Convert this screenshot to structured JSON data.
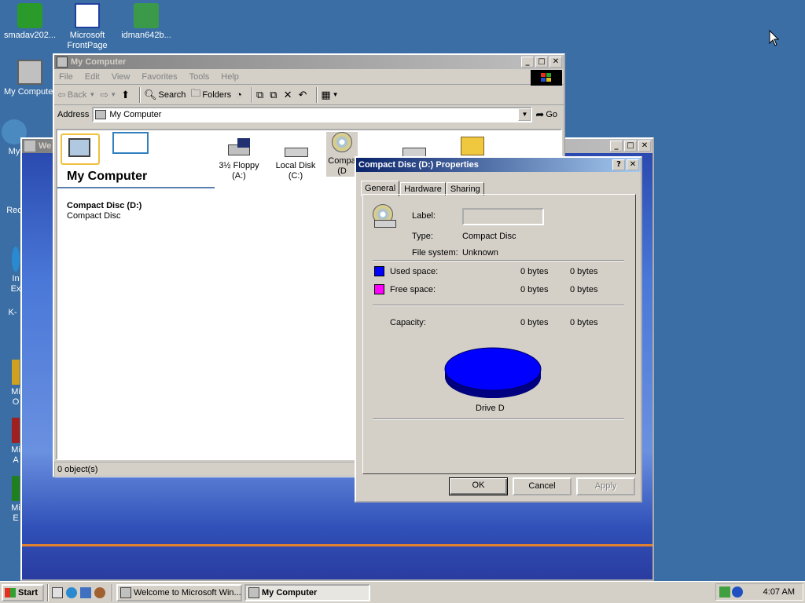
{
  "desktop": {
    "icons": [
      {
        "label": "smadav202..."
      },
      {
        "label": "Microsoft FrontPage"
      },
      {
        "label": "idman642b..."
      },
      {
        "label": "My Computer"
      },
      {
        "label": "My"
      },
      {
        "label": "Rec"
      },
      {
        "label": "In Ex"
      },
      {
        "label": "K-"
      },
      {
        "label": "Mi O"
      },
      {
        "label": "Mi A"
      },
      {
        "label": "Mi E"
      }
    ]
  },
  "background_window": {
    "title": "We"
  },
  "explorer": {
    "title": "My Computer",
    "menu": [
      "File",
      "Edit",
      "View",
      "Favorites",
      "Tools",
      "Help"
    ],
    "toolbar": {
      "back": "Back",
      "search": "Search",
      "folders": "Folders"
    },
    "address": {
      "label": "Address",
      "value": "My Computer",
      "go": "Go"
    },
    "left_pane": {
      "heading": "My Computer",
      "selected_name": "Compact Disc (D:)",
      "selected_type": "Compact Disc"
    },
    "drives": [
      {
        "label": "3½ Floppy (A:)"
      },
      {
        "label": "Local Disk (C:)"
      },
      {
        "label": "Compa (D"
      }
    ],
    "status": "0 object(s)"
  },
  "properties": {
    "title": "Compact Disc (D:) Properties",
    "tabs": [
      "General",
      "Hardware",
      "Sharing"
    ],
    "label_field": {
      "label": "Label:",
      "value": ""
    },
    "type": {
      "label": "Type:",
      "value": "Compact Disc"
    },
    "filesystem": {
      "label": "File system:",
      "value": "Unknown"
    },
    "used": {
      "label": "Used space:",
      "bytes": "0 bytes",
      "size": "0 bytes",
      "color": "#0000ff"
    },
    "free": {
      "label": "Free space:",
      "bytes": "0 bytes",
      "size": "0 bytes",
      "color": "#ff00ff"
    },
    "capacity": {
      "label": "Capacity:",
      "bytes": "0 bytes",
      "size": "0 bytes"
    },
    "drive_caption": "Drive D",
    "buttons": {
      "ok": "OK",
      "cancel": "Cancel",
      "apply": "Apply"
    }
  },
  "taskbar": {
    "start": "Start",
    "tasks": [
      {
        "label": "Welcome to Microsoft Win..."
      },
      {
        "label": "My Computer"
      }
    ],
    "clock": "4:07 AM"
  },
  "colors": {
    "desktop": "#3a6ea5",
    "active_title": "#0a246a",
    "face": "#d4d0c8"
  }
}
